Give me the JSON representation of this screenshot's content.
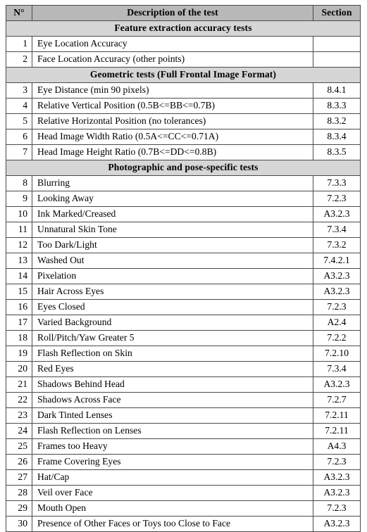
{
  "table": {
    "columns": [
      {
        "key": "number",
        "label": "N°"
      },
      {
        "key": "description",
        "label": "Description of the test"
      },
      {
        "key": "section",
        "label": "Section"
      }
    ],
    "colors": {
      "header_background": "#b8b8b8",
      "group_background": "#d6d6d6",
      "row_background": "#ffffff",
      "border": "#4a4a4a",
      "text": "#000000"
    },
    "rows": [
      {
        "kind": "group",
        "title": "Feature extraction accuracy tests"
      },
      {
        "kind": "data",
        "number": "1",
        "description": "Eye Location Accuracy",
        "section": ""
      },
      {
        "kind": "data",
        "number": "2",
        "description": "Face Location Accuracy (other points)",
        "section": ""
      },
      {
        "kind": "group",
        "title": "Geometric tests (Full Frontal Image Format)"
      },
      {
        "kind": "data",
        "number": "3",
        "description": "Eye Distance (min 90 pixels)",
        "section": "8.4.1"
      },
      {
        "kind": "data",
        "number": "4",
        "description": "Relative Vertical Position (0.5B<=BB<=0.7B)",
        "section": "8.3.3"
      },
      {
        "kind": "data",
        "number": "5",
        "description": "Relative Horizontal Position (no tolerances)",
        "section": "8.3.2"
      },
      {
        "kind": "data",
        "number": "6",
        "description": "Head Image Width Ratio (0.5A<=CC<=0.71A)",
        "section": "8.3.4"
      },
      {
        "kind": "data",
        "number": "7",
        "description": "Head Image Height Ratio (0.7B<=DD<=0.8B)",
        "section": "8.3.5"
      },
      {
        "kind": "group",
        "title": "Photographic and pose-specific tests"
      },
      {
        "kind": "data",
        "number": "8",
        "description": "Blurring",
        "section": "7.3.3"
      },
      {
        "kind": "data",
        "number": "9",
        "description": "Looking Away",
        "section": "7.2.3"
      },
      {
        "kind": "data",
        "number": "10",
        "description": "Ink Marked/Creased",
        "section": "A3.2.3"
      },
      {
        "kind": "data",
        "number": "11",
        "description": "Unnatural Skin Tone",
        "section": "7.3.4"
      },
      {
        "kind": "data",
        "number": "12",
        "description": "Too Dark/Light",
        "section": "7.3.2"
      },
      {
        "kind": "data",
        "number": "13",
        "description": "Washed Out",
        "section": "7.4.2.1"
      },
      {
        "kind": "data",
        "number": "14",
        "description": "Pixelation",
        "section": "A3.2.3"
      },
      {
        "kind": "data",
        "number": "15",
        "description": "Hair Across Eyes",
        "section": "A3.2.3"
      },
      {
        "kind": "data",
        "number": "16",
        "description": "Eyes Closed",
        "section": "7.2.3"
      },
      {
        "kind": "data",
        "number": "17",
        "description": "Varied Background",
        "section": "A2.4"
      },
      {
        "kind": "data",
        "number": "18",
        "description": "Roll/Pitch/Yaw Greater 5",
        "section": "7.2.2"
      },
      {
        "kind": "data",
        "number": "19",
        "description": "Flash Reflection on Skin",
        "section": "7.2.10"
      },
      {
        "kind": "data",
        "number": "20",
        "description": "Red Eyes",
        "section": "7.3.4"
      },
      {
        "kind": "data",
        "number": "21",
        "description": "Shadows Behind Head",
        "section": "A3.2.3"
      },
      {
        "kind": "data",
        "number": "22",
        "description": "Shadows Across Face",
        "section": "7.2.7"
      },
      {
        "kind": "data",
        "number": "23",
        "description": "Dark Tinted Lenses",
        "section": "7.2.11"
      },
      {
        "kind": "data",
        "number": "24",
        "description": "Flash Reflection on Lenses",
        "section": "7.2.11"
      },
      {
        "kind": "data",
        "number": "25",
        "description": "Frames too Heavy",
        "section": "A4.3"
      },
      {
        "kind": "data",
        "number": "26",
        "description": "Frame Covering Eyes",
        "section": "7.2.3"
      },
      {
        "kind": "data",
        "number": "27",
        "description": "Hat/Cap",
        "section": "A3.2.3"
      },
      {
        "kind": "data",
        "number": "28",
        "description": "Veil over Face",
        "section": "A3.2.3"
      },
      {
        "kind": "data",
        "number": "29",
        "description": "Mouth Open",
        "section": "7.2.3"
      },
      {
        "kind": "data",
        "number": "30",
        "description": "Presence of Other Faces or Toys too Close to Face",
        "section": "A3.2.3"
      }
    ]
  }
}
